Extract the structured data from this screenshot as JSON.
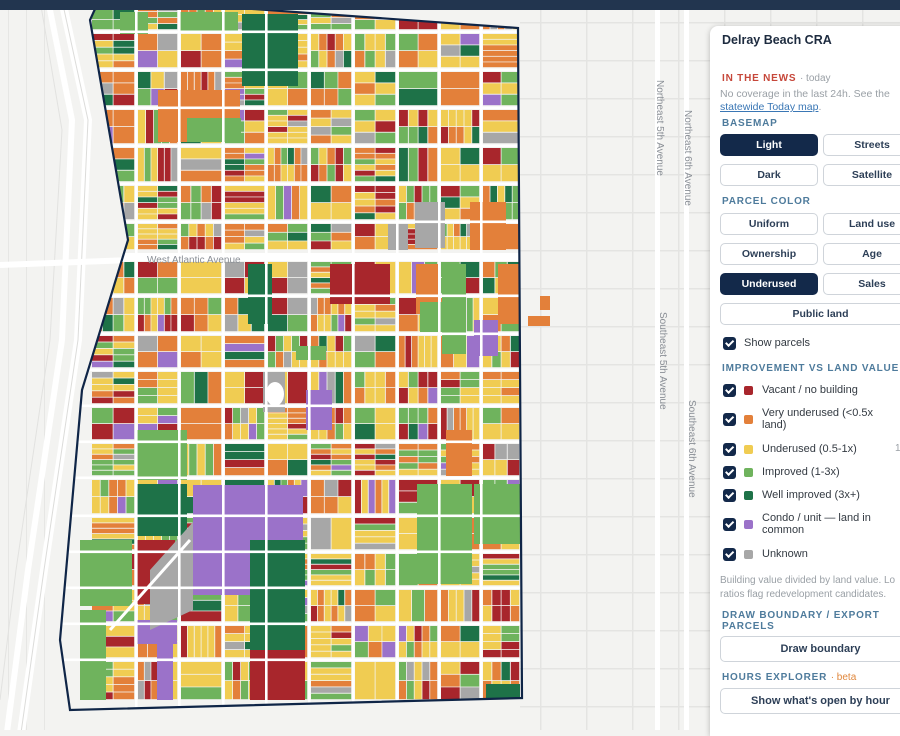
{
  "panel": {
    "title": "Delray Beach CRA",
    "news": {
      "heading": "In the news",
      "time": "· today",
      "text": "No coverage in the last 24h. See the ",
      "link": "statewide Today map",
      "text_end": "."
    },
    "basemap": {
      "heading": "Basemap",
      "options": [
        "Light",
        "Streets",
        "Dark",
        "Satellite"
      ],
      "selected": "Light"
    },
    "parcel_color": {
      "heading": "Parcel color",
      "options": [
        "Uniform",
        "Land use",
        "Ownership",
        "Age",
        "Underused",
        "Sales",
        "Public land"
      ],
      "selected": "Underused"
    },
    "show_parcels": {
      "label": "Show parcels",
      "checked": true
    },
    "legend": {
      "heading": "Improvement vs land value",
      "items": [
        {
          "label": "Vacant / no building",
          "color": "#a8262c",
          "checked": true
        },
        {
          "label": "Very underused (<0.5x land)",
          "color": "#e3803a",
          "checked": true
        },
        {
          "label": "Underused (0.5-1x)",
          "color": "#f0cc52",
          "checked": true
        },
        {
          "label": "Improved (1-3x)",
          "color": "#6fb35d",
          "checked": true
        },
        {
          "label": "Well improved (3x+)",
          "color": "#1e7248",
          "checked": true
        },
        {
          "label": "Condo / unit — land in common",
          "color": "#9b72c9",
          "checked": true
        },
        {
          "label": "Unknown",
          "color": "#a7a7a7",
          "checked": true
        }
      ],
      "side_number": "1",
      "note": "Building value divided by land value. Lo ratios flag redevelopment candidates."
    },
    "draw": {
      "heading": "Draw boundary / export parcels",
      "button": "Draw boundary"
    },
    "hours": {
      "heading": "Hours explorer",
      "badge": "· beta",
      "button": "Show what's open by hour"
    }
  },
  "map": {
    "street_labels": [
      "West Atlantic Avenue",
      "Northeast 5th Avenue",
      "Northeast 6th Avenue",
      "Southeast 5th Avenue",
      "Southeast 6th Avenue"
    ],
    "boundary_color": "#0f2547",
    "colors": {
      "vacant": "#a8262c",
      "very_underused": "#e3803a",
      "underused": "#f0cc52",
      "improved": "#6fb35d",
      "well_improved": "#1e7248",
      "condo": "#9b72c9",
      "unknown": "#a7a7a7"
    }
  }
}
